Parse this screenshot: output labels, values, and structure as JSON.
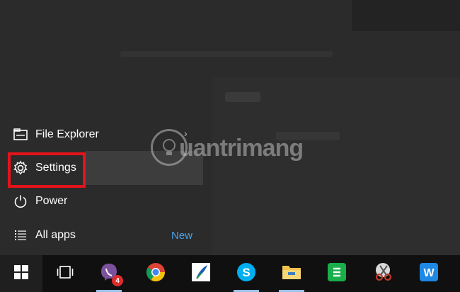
{
  "start_menu": {
    "items": [
      {
        "label": "File Explorer",
        "icon": "file-explorer-icon"
      },
      {
        "label": "Settings",
        "icon": "gear-icon"
      },
      {
        "label": "Power",
        "icon": "power-icon"
      },
      {
        "label": "All apps",
        "icon": "list-icon",
        "badge": "New"
      }
    ]
  },
  "watermark": {
    "text": "uantrimang",
    "icon": "lightbulb-icon"
  },
  "taskbar": {
    "apps": [
      {
        "name": "start",
        "icon": "windows-logo-icon"
      },
      {
        "name": "task-view",
        "icon": "task-view-icon"
      },
      {
        "name": "viber",
        "icon": "viber-icon",
        "badge": "4"
      },
      {
        "name": "chrome",
        "icon": "chrome-icon"
      },
      {
        "name": "quill",
        "icon": "quill-icon"
      },
      {
        "name": "skype",
        "icon": "skype-icon"
      },
      {
        "name": "file-explorer",
        "icon": "folder-icon"
      },
      {
        "name": "sheets",
        "icon": "spreadsheet-icon"
      },
      {
        "name": "snipping-tool",
        "icon": "scissors-icon"
      },
      {
        "name": "wps-writer",
        "icon": "writer-icon"
      }
    ]
  },
  "colors": {
    "accent": "#4aa3e6",
    "highlight": "#e3131c",
    "taskbar": "#101010"
  }
}
